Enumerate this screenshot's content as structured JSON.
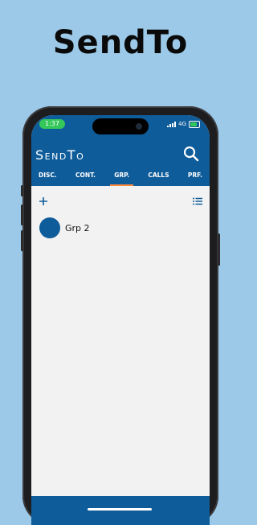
{
  "promo": {
    "title": "SendTo"
  },
  "status": {
    "time": "1:37",
    "network": "4G"
  },
  "app": {
    "title": "SendTo"
  },
  "tabs": [
    {
      "label": "DISC."
    },
    {
      "label": "CONT."
    },
    {
      "label": "GRP.",
      "active": true
    },
    {
      "label": "CALLS"
    },
    {
      "label": "PRF."
    }
  ],
  "toolbar": {
    "add_icon": "plus-icon",
    "list_icon": "list-icon"
  },
  "groups": [
    {
      "name": "Grp 2"
    }
  ],
  "colors": {
    "brand": "#0f5c9a",
    "accent": "#ff8a3d",
    "background": "#9cc9e8",
    "screen": "#f2f2f2"
  }
}
